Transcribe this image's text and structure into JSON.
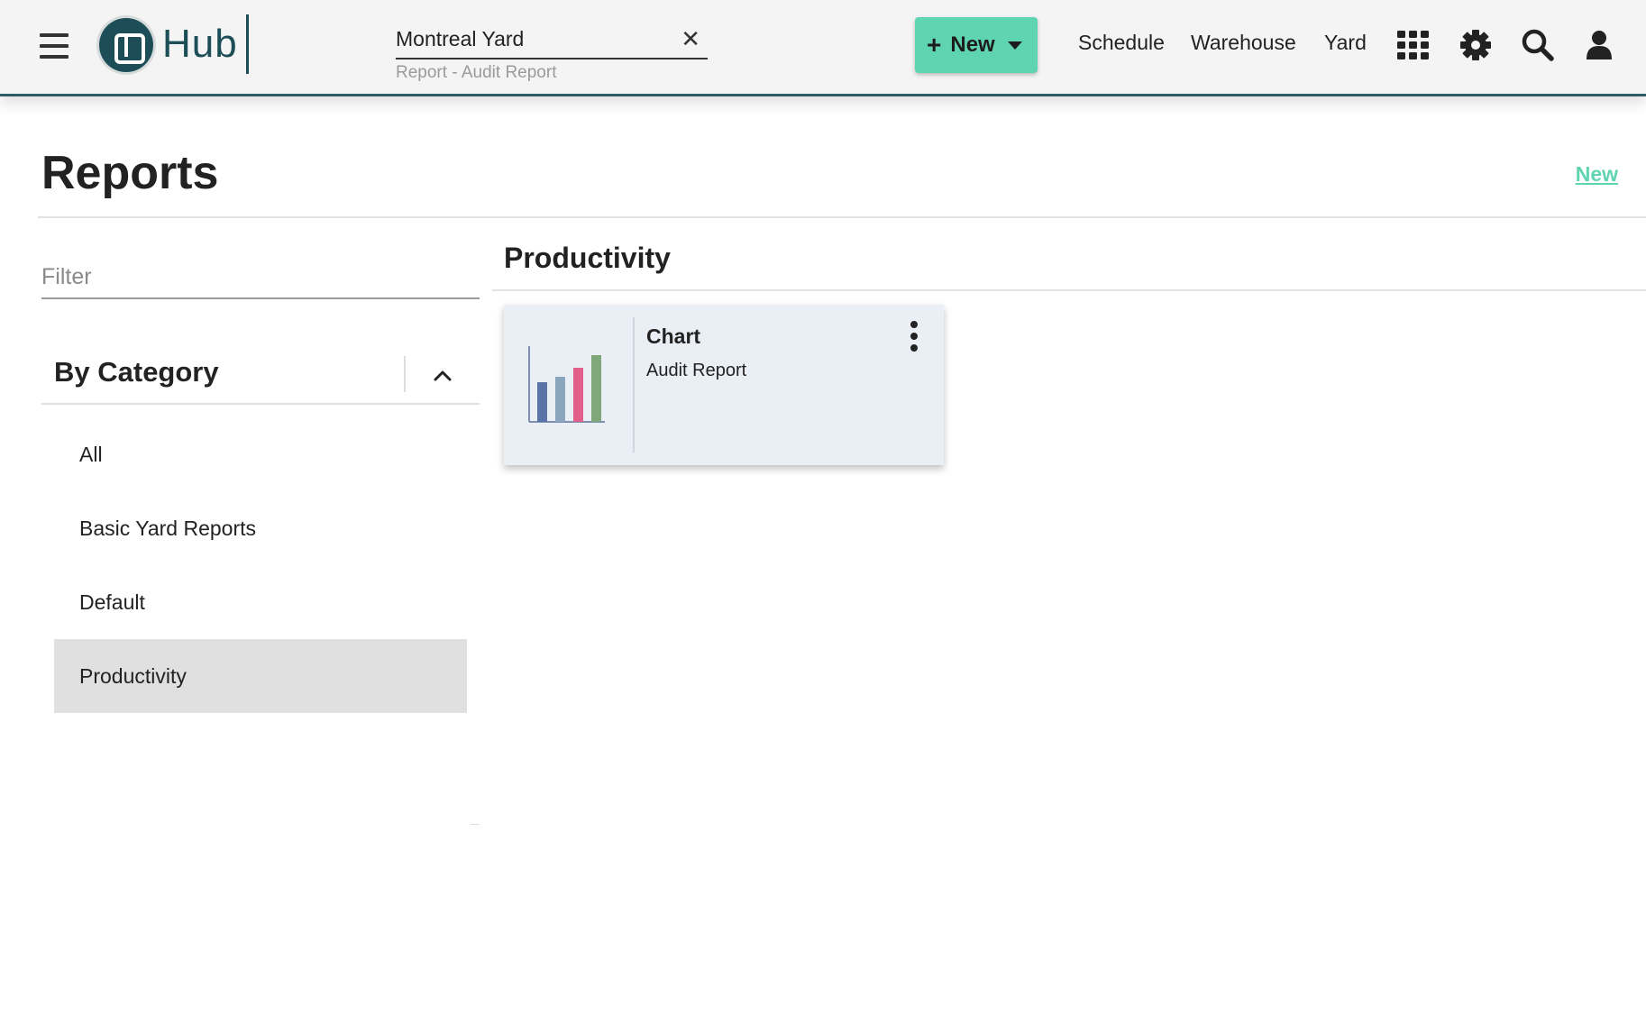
{
  "header": {
    "logo_text": "Hub",
    "yard_select": {
      "value": "Montreal Yard",
      "subtitle": "Report - Audit Report"
    },
    "new_button_label": "New",
    "nav": [
      "Schedule",
      "Warehouse",
      "Yard"
    ],
    "icons": [
      "menu-icon",
      "apps-grid-icon",
      "gear-icon",
      "search-icon",
      "user-icon"
    ]
  },
  "page": {
    "title": "Reports",
    "new_link": "New"
  },
  "sidebar": {
    "filter_placeholder": "Filter",
    "category_title": "By Category",
    "categories": [
      {
        "label": "All",
        "active": false
      },
      {
        "label": "Basic Yard Reports",
        "active": false
      },
      {
        "label": "Default",
        "active": false
      },
      {
        "label": "Productivity",
        "active": true
      }
    ]
  },
  "main": {
    "section_title": "Productivity",
    "cards": [
      {
        "title": "Chart",
        "subtitle": "Audit Report",
        "thumb_icon": "bar-chart-icon"
      }
    ]
  },
  "colors": {
    "brand": "#1d4e57",
    "accent": "#5fd4b0",
    "active_item": "#e0e0e0",
    "card_bg": "#eaeef5",
    "chart_bars": [
      "#5a74a8",
      "#8aa6bf",
      "#e0608a",
      "#7fa87a"
    ]
  }
}
